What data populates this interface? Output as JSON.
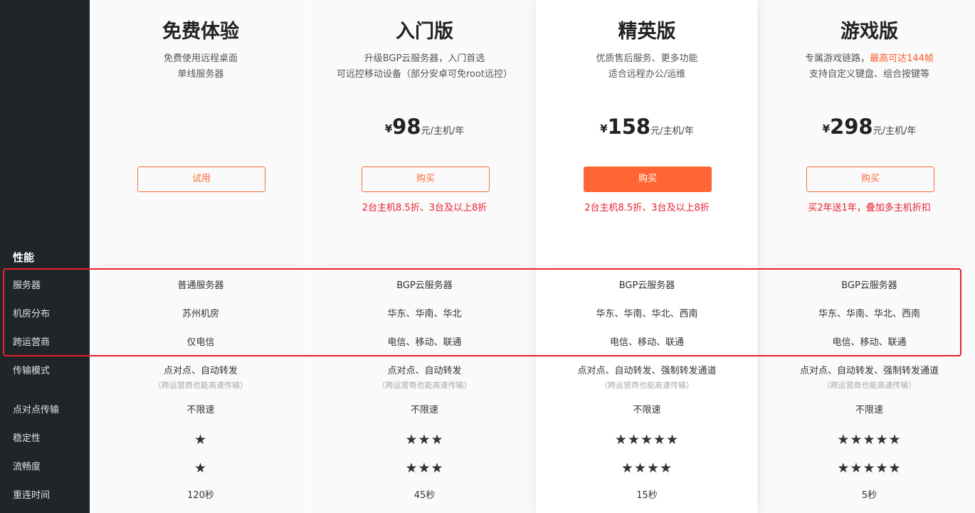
{
  "sidebar": {
    "section_title": "性能",
    "rows": [
      "服务器",
      "机房分布",
      "跨运营商",
      "传输模式",
      "点对点传输",
      "稳定性",
      "流畅度",
      "重连时间"
    ]
  },
  "plans": [
    {
      "name": "免费体验",
      "desc_line1": "免费使用远程桌面",
      "desc_line2": "单线服务器",
      "price": null,
      "button": "试用",
      "promo": "",
      "server": "普通服务器",
      "regions": "苏州机房",
      "cross_isp": "仅电信",
      "transfer_mode": "点对点、自动转发",
      "transfer_note": "（跨运营商也能高速传输）",
      "p2p": "不限速",
      "stability": "★",
      "smoothness": "★",
      "reconnect": "120秒"
    },
    {
      "name": "入门版",
      "desc_line1": "升级BGP云服务器，入门首选",
      "desc_line2": "可远控移动设备（部分安卓可免root远控）",
      "price": {
        "currency": "¥",
        "amount": "98",
        "unit": "元/主机/年"
      },
      "button": "购买",
      "promo": "2台主机8.5折、3台及以上8折",
      "server": "BGP云服务器",
      "regions": "华东、华南、华北",
      "cross_isp": "电信、移动、联通",
      "transfer_mode": "点对点、自动转发",
      "transfer_note": "（跨运营商也能高速传输）",
      "p2p": "不限速",
      "stability": "★★★",
      "smoothness": "★★★",
      "reconnect": "45秒"
    },
    {
      "name": "精英版",
      "desc_line1": "优质售后服务、更多功能",
      "desc_line2": "适合远程办公/运维",
      "price": {
        "currency": "¥",
        "amount": "158",
        "unit": "元/主机/年"
      },
      "button": "购买",
      "promo": "2台主机8.5折、3台及以上8折",
      "server": "BGP云服务器",
      "regions": "华东、华南、华北、西南",
      "cross_isp": "电信、移动、联通",
      "transfer_mode": "点对点、自动转发、强制转发通道",
      "transfer_note": "（跨运营商也能高速传输）",
      "p2p": "不限速",
      "stability": "★★★★★",
      "smoothness": "★★★★",
      "reconnect": "15秒"
    },
    {
      "name": "游戏版",
      "desc_line1_prefix": "专属游戏链路，",
      "desc_line1_highlight": "最高可达144帧",
      "desc_line2": "支持自定义键盘、组合按键等",
      "price": {
        "currency": "¥",
        "amount": "298",
        "unit": "元/主机/年"
      },
      "button": "购买",
      "promo": "买2年送1年，叠加多主机折扣",
      "server": "BGP云服务器",
      "regions": "华东、华南、华北、西南",
      "cross_isp": "电信、移动、联通",
      "transfer_mode": "点对点、自动转发、强制转发通道",
      "transfer_note": "（跨运营商也能高速传输）",
      "p2p": "不限速",
      "stability": "★★★★★",
      "smoothness": "★★★★★",
      "reconnect": "5秒"
    }
  ],
  "colors": {
    "accent": "#ff6633",
    "promo": "#e8202c",
    "sidebar_bg": "#1f2529",
    "annotation": "#e8222a"
  }
}
